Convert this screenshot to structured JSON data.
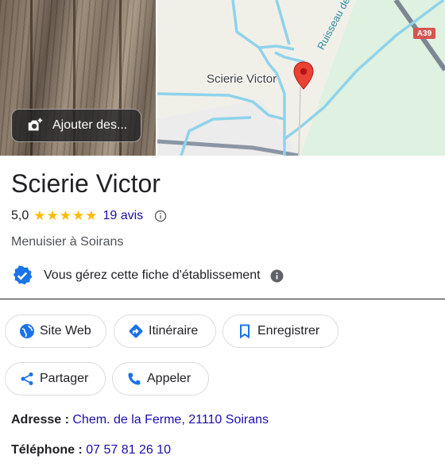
{
  "photo": {
    "add_label": "Ajouter des..."
  },
  "map": {
    "place_label": "Scierie Victor",
    "road_badge": "A39",
    "river_label": "Ruisseau de la Dame"
  },
  "place": {
    "name": "Scierie Victor",
    "rating": "5,0",
    "stars": "★★★★★",
    "reviews": "19 avis",
    "category": "Menuisier à Soirans",
    "manage_text": "Vous gérez cette fiche d'établissement"
  },
  "actions": {
    "website": "Site Web",
    "directions": "Itinéraire",
    "save": "Enregistrer",
    "share": "Partager",
    "call": "Appeler"
  },
  "details": {
    "address_label": "Adresse :",
    "address_value": "Chem. de la Ferme, 21110 Soirans",
    "phone_label": "Téléphone :",
    "phone_value": "07 57 81 26 10"
  },
  "colors": {
    "accent": "#1a73e8",
    "link": "#1a0dab",
    "star": "#fbbc04",
    "pin": "#ea4335"
  }
}
